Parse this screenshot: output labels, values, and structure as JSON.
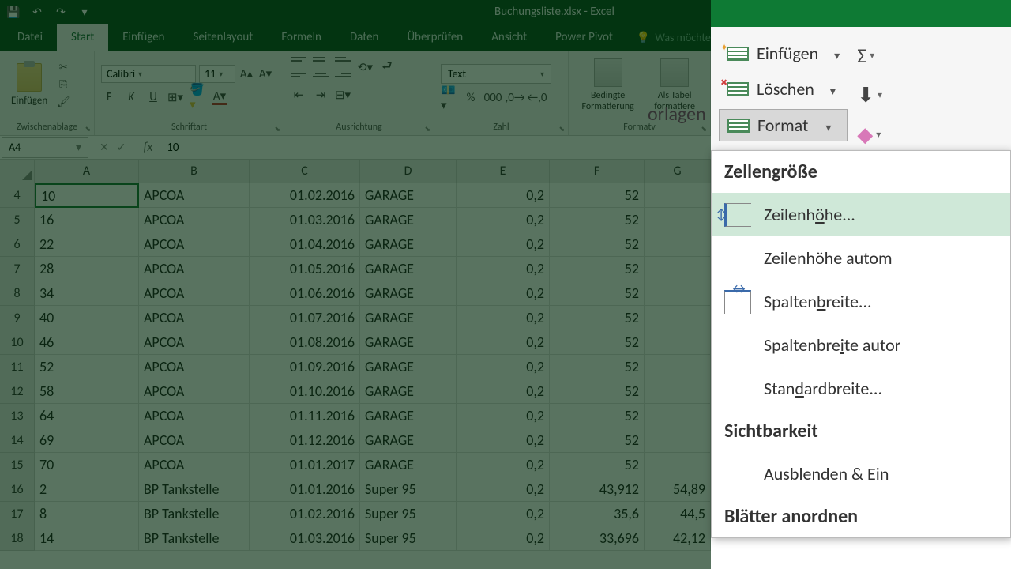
{
  "title": "Buchungsliste.xlsx - Excel",
  "qat": {
    "save": "💾",
    "undo": "↶",
    "redo": "↷",
    "more": "▾"
  },
  "tabs": {
    "datei": "Datei",
    "start": "Start",
    "einfuegen": "Einfügen",
    "seitenlayout": "Seitenlayout",
    "formeln": "Formeln",
    "daten": "Daten",
    "ueberpruefen": "Überprüfen",
    "ansicht": "Ansicht",
    "powerpivot": "Power Pivot",
    "tellme": "Was möchte"
  },
  "groups": {
    "clipboard": "Zwischenablage",
    "font": "Schriftart",
    "alignment": "Ausrichtung",
    "number": "Zahl",
    "einfuegen_btn": "Einfügen",
    "bedingte": "Bedingte Formatierung",
    "als_tabelle": "Als Tabel formatiere",
    "formatv": "Formatv"
  },
  "font": {
    "name": "Calibri",
    "size": "11",
    "format": "Text"
  },
  "namebox": "A4",
  "formula": "10",
  "columns": [
    "A",
    "B",
    "C",
    "D",
    "E",
    "F",
    "G"
  ],
  "rows": [
    {
      "n": "4",
      "a": "10",
      "b": "APCOA",
      "c": "01.02.2016",
      "d": "GARAGE",
      "e": "0,2",
      "f": "52",
      "g": ""
    },
    {
      "n": "5",
      "a": "16",
      "b": "APCOA",
      "c": "01.03.2016",
      "d": "GARAGE",
      "e": "0,2",
      "f": "52",
      "g": ""
    },
    {
      "n": "6",
      "a": "22",
      "b": "APCOA",
      "c": "01.04.2016",
      "d": "GARAGE",
      "e": "0,2",
      "f": "52",
      "g": ""
    },
    {
      "n": "7",
      "a": "28",
      "b": "APCOA",
      "c": "01.05.2016",
      "d": "GARAGE",
      "e": "0,2",
      "f": "52",
      "g": ""
    },
    {
      "n": "8",
      "a": "34",
      "b": "APCOA",
      "c": "01.06.2016",
      "d": "GARAGE",
      "e": "0,2",
      "f": "52",
      "g": ""
    },
    {
      "n": "9",
      "a": "40",
      "b": "APCOA",
      "c": "01.07.2016",
      "d": "GARAGE",
      "e": "0,2",
      "f": "52",
      "g": ""
    },
    {
      "n": "10",
      "a": "46",
      "b": "APCOA",
      "c": "01.08.2016",
      "d": "GARAGE",
      "e": "0,2",
      "f": "52",
      "g": ""
    },
    {
      "n": "11",
      "a": "52",
      "b": "APCOA",
      "c": "01.09.2016",
      "d": "GARAGE",
      "e": "0,2",
      "f": "52",
      "g": ""
    },
    {
      "n": "12",
      "a": "58",
      "b": "APCOA",
      "c": "01.10.2016",
      "d": "GARAGE",
      "e": "0,2",
      "f": "52",
      "g": ""
    },
    {
      "n": "13",
      "a": "64",
      "b": "APCOA",
      "c": "01.11.2016",
      "d": "GARAGE",
      "e": "0,2",
      "f": "52",
      "g": ""
    },
    {
      "n": "14",
      "a": "69",
      "b": "APCOA",
      "c": "01.12.2016",
      "d": "GARAGE",
      "e": "0,2",
      "f": "52",
      "g": ""
    },
    {
      "n": "15",
      "a": "70",
      "b": "APCOA",
      "c": "01.01.2017",
      "d": "GARAGE",
      "e": "0,2",
      "f": "52",
      "g": ""
    },
    {
      "n": "16",
      "a": "2",
      "b": "BP Tankstelle",
      "c": "01.01.2016",
      "d": "Super 95",
      "e": "0,2",
      "f": "43,912",
      "g": "54,89"
    },
    {
      "n": "17",
      "a": "8",
      "b": "BP Tankstelle",
      "c": "01.02.2016",
      "d": "Super 95",
      "e": "0,2",
      "f": "35,6",
      "g": "44,5"
    },
    {
      "n": "18",
      "a": "14",
      "b": "BP Tankstelle",
      "c": "01.03.2016",
      "d": "Super 95",
      "e": "0,2",
      "f": "33,696",
      "g": "42,12"
    }
  ],
  "right_panel": {
    "vorlagen": "orlagen",
    "einfuegen": "Einfügen",
    "loeschen": "Löschen",
    "format": "Format",
    "sigma": "Σ",
    "fill": "⬇",
    "clear": "◆"
  },
  "dropdown": {
    "zellengroesse": "Zellengröße",
    "zeilenhoehe": "Zeilenhöhe...",
    "zeilenhoehe_auto": "Zeilenhöhe autom",
    "spaltenbreite": "Spaltenbreite...",
    "spaltenbreite_auto": "Spaltenbreite autor",
    "standardbreite": "Standardbreite...",
    "sichtbarkeit": "Sichtbarkeit",
    "ausblenden": "Ausblenden & Ein",
    "blaetter": "Blätter anordnen"
  },
  "extra": {
    "r16": "54,89",
    "r17": "44,5",
    "r18": "42,12"
  }
}
